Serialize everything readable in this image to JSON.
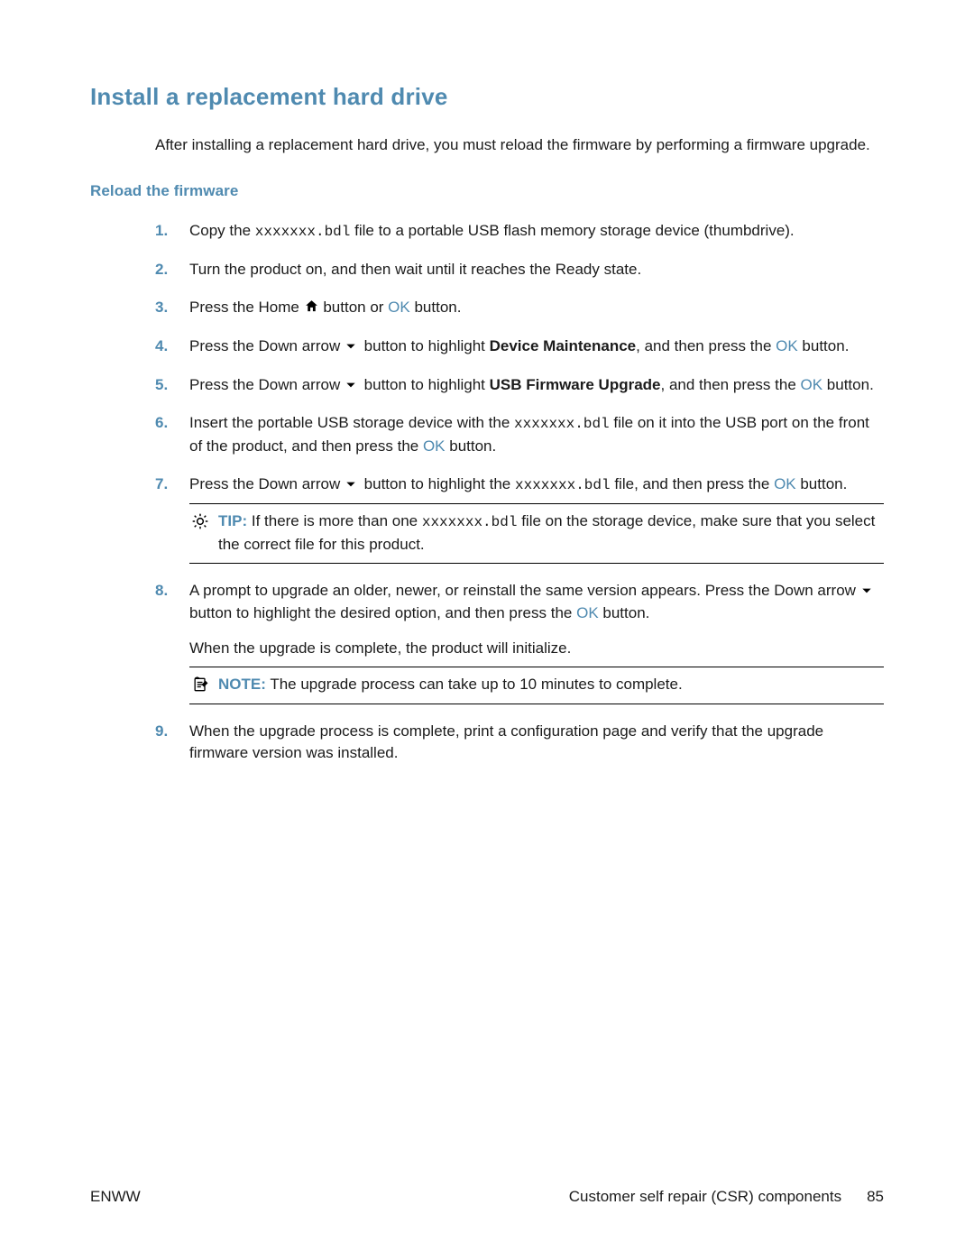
{
  "heading1": "Install a replacement hard drive",
  "intro": "After installing a replacement hard drive, you must reload the firmware by performing a firmware upgrade.",
  "heading2": "Reload the firmware",
  "filename": "xxxxxxx.bdl",
  "ok": "OK",
  "steps": {
    "s1a": "Copy the ",
    "s1b": " file to a portable USB flash memory storage device (thumbdrive).",
    "s2": "Turn the product on, and then wait until it reaches the Ready state.",
    "s3a": "Press the Home ",
    "s3b": " button or ",
    "s3c": " button.",
    "s4a": "Press the Down arrow ",
    "s4b": " button to highlight ",
    "s4_bold": "Device Maintenance",
    "s4c": ", and then press the ",
    "s4d": " button.",
    "s5a": "Press the Down arrow ",
    "s5b": " button to highlight ",
    "s5_bold": "USB Firmware Upgrade",
    "s5c": ", and then press the ",
    "s5d": " button.",
    "s6a": "Insert the portable USB storage device with the ",
    "s6b": " file on it into the USB port on the front of the product, and then press the ",
    "s6c": " button.",
    "s7a": "Press the Down arrow ",
    "s7b": " button to highlight the ",
    "s7c": " file, and then press the ",
    "s7d": " button.",
    "s8a": "A prompt to upgrade an older, newer, or reinstall the same version appears. Press the Down arrow ",
    "s8b": " button to highlight the desired option, and then press the ",
    "s8c": " button.",
    "s8_sub": "When the upgrade is complete, the product will initialize.",
    "s9": "When the upgrade process is complete, print a configuration page and verify that the upgrade firmware version was installed."
  },
  "tip": {
    "label": "TIP:",
    "a": "If there is more than one ",
    "b": " file on the storage device, make sure that you select the correct file for this product."
  },
  "note": {
    "label": "NOTE:",
    "text": "The upgrade process can take up to 10 minutes to complete."
  },
  "footer": {
    "left": "ENWW",
    "right_text": "Customer self repair (CSR) components",
    "page": "85"
  }
}
